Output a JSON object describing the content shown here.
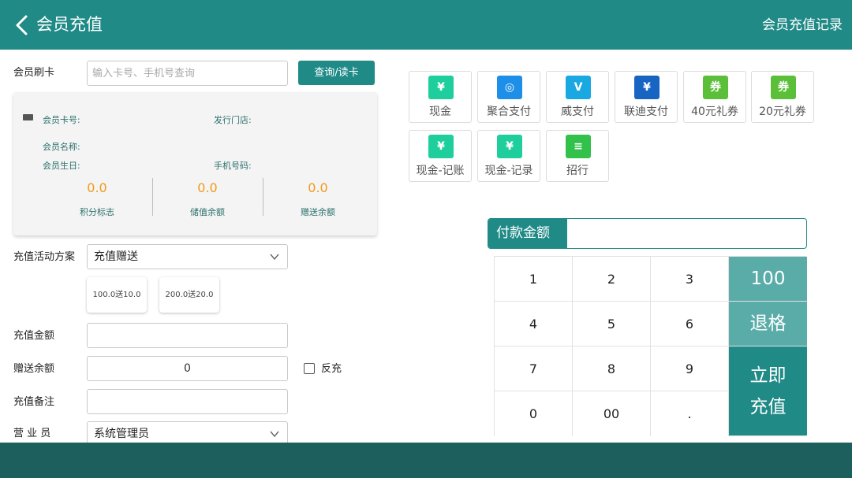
{
  "header": {
    "back_icon": "chevron-left-icon",
    "title": "会员充值",
    "record_label": "会员充值记录"
  },
  "card_swipe": {
    "label": "会员刷卡",
    "placeholder": "输入卡号、手机号查询",
    "query_button": "查询/读卡"
  },
  "member_card": {
    "card_no_label": "会员卡号:",
    "store_label": "发行门店:",
    "name_label": "会员名称:",
    "birthday_label": "会员生日:",
    "phone_label": "手机号码:",
    "stats": [
      {
        "value": "0.0",
        "label": "积分标志"
      },
      {
        "value": "0.0",
        "label": "储值余额"
      },
      {
        "value": "0.0",
        "label": "赠送余额"
      }
    ]
  },
  "plan": {
    "label": "充值活动方案",
    "selected": "充值赠送",
    "options": [
      "100.0送10.0",
      "200.0送20.0"
    ]
  },
  "recharge_amount": {
    "label": "充值金额",
    "value": ""
  },
  "gift_balance": {
    "label": "赠送余额",
    "value": "0",
    "reverse_label": "反充",
    "reverse_checked": false
  },
  "remark": {
    "label": "充值备注",
    "value": ""
  },
  "clerk": {
    "label": "营 业 员",
    "selected": "系统管理员"
  },
  "payments": [
    {
      "label": "现金",
      "icon": "cash-icon",
      "glyph": "¥",
      "color": "#1ecf9d"
    },
    {
      "label": "聚合支付",
      "icon": "aggregate-pay-icon",
      "glyph": "◎",
      "color": "#1e8fe8"
    },
    {
      "label": "威支付",
      "icon": "v-pay-icon",
      "glyph": "V",
      "color": "#1aa8e2"
    },
    {
      "label": "联迪支付",
      "icon": "landi-pay-icon",
      "glyph": "¥",
      "color": "#1764c2"
    },
    {
      "label": "40元礼券",
      "icon": "coupon-icon",
      "glyph": "券",
      "color": "#5bbf3a"
    },
    {
      "label": "20元礼券",
      "icon": "coupon-icon",
      "glyph": "券",
      "color": "#5bbf3a"
    },
    {
      "label": "现金-记账",
      "icon": "cash-icon",
      "glyph": "¥",
      "color": "#1ecf9d"
    },
    {
      "label": "现金-记录",
      "icon": "cash-icon",
      "glyph": "¥",
      "color": "#1ecf9d"
    },
    {
      "label": "招行",
      "icon": "bank-card-icon",
      "glyph": "≡",
      "color": "#32c14a"
    }
  ],
  "pay_amount": {
    "label": "付款金额",
    "value": ""
  },
  "keypad": {
    "keys": [
      "1",
      "2",
      "3",
      "4",
      "5",
      "6",
      "7",
      "8",
      "9",
      "0",
      "00",
      "."
    ],
    "quick_100": "100",
    "backspace": "退格",
    "confirm_line1": "立即",
    "confirm_line2": "充值"
  }
}
